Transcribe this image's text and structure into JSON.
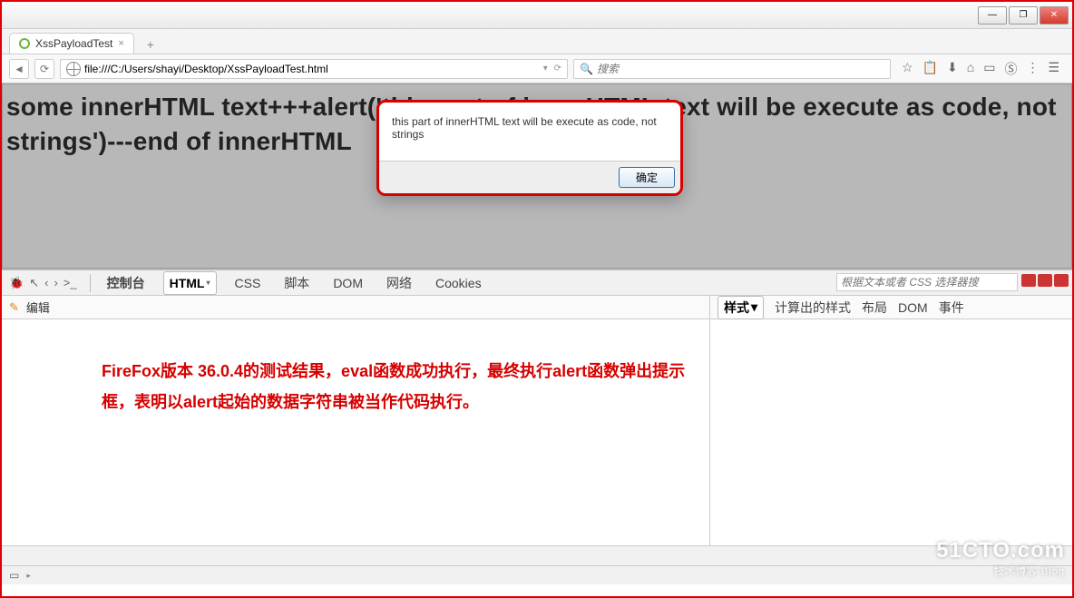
{
  "window": {
    "min": "—",
    "max": "❐",
    "close": "✕"
  },
  "tab": {
    "title": "XssPayloadTest",
    "close": "×",
    "new": "+"
  },
  "nav": {
    "back": "◄",
    "reload": "⟳"
  },
  "address": {
    "url": "file:///C:/Users/shayi/Desktop/XssPayloadTest.html",
    "dropdown": "▾",
    "reload": "⟳"
  },
  "search": {
    "placeholder": "搜索",
    "icon": "🔍"
  },
  "toolbar": {
    "star": "☆",
    "clip": "📋",
    "down": "⬇",
    "home": "⌂",
    "book": "▭",
    "skype": "Ⓢ",
    "bullets": "⋮",
    "menu": "☰"
  },
  "page": {
    "heading": "some innerHTML text+++alert('this part of innerHTML text will be execute as code, not strings')---end of innerHTML"
  },
  "alert": {
    "message": "this part of innerHTML text will be execute as code, not strings",
    "ok": "确定"
  },
  "devtools": {
    "icons": {
      "bug": "🐞",
      "point": "↖",
      "left": "‹",
      "right": "›",
      "console": ">_"
    },
    "tabs": {
      "console": "控制台",
      "html": "HTML",
      "css": "CSS",
      "script": "脚本",
      "dom": "DOM",
      "net": "网络",
      "cookies": "Cookies"
    },
    "search_placeholder": "根据文本或者 CSS 选择器搜",
    "edit_icon": "✎",
    "edit": "编辑",
    "panels": {
      "style": "样式",
      "computed": "计算出的样式",
      "layout": "布局",
      "dom": "DOM",
      "events": "事件"
    },
    "annotation": "FireFox版本 36.0.4的测试结果，eval函数成功执行，最终执行alert函数弹出提示框，表明以alert起始的数据字符串被当作代码执行。",
    "status": {
      "box": "▭",
      "tri": "▸"
    }
  },
  "watermark": {
    "main": "51CTO.com",
    "sub": "技术博客  Blog"
  }
}
